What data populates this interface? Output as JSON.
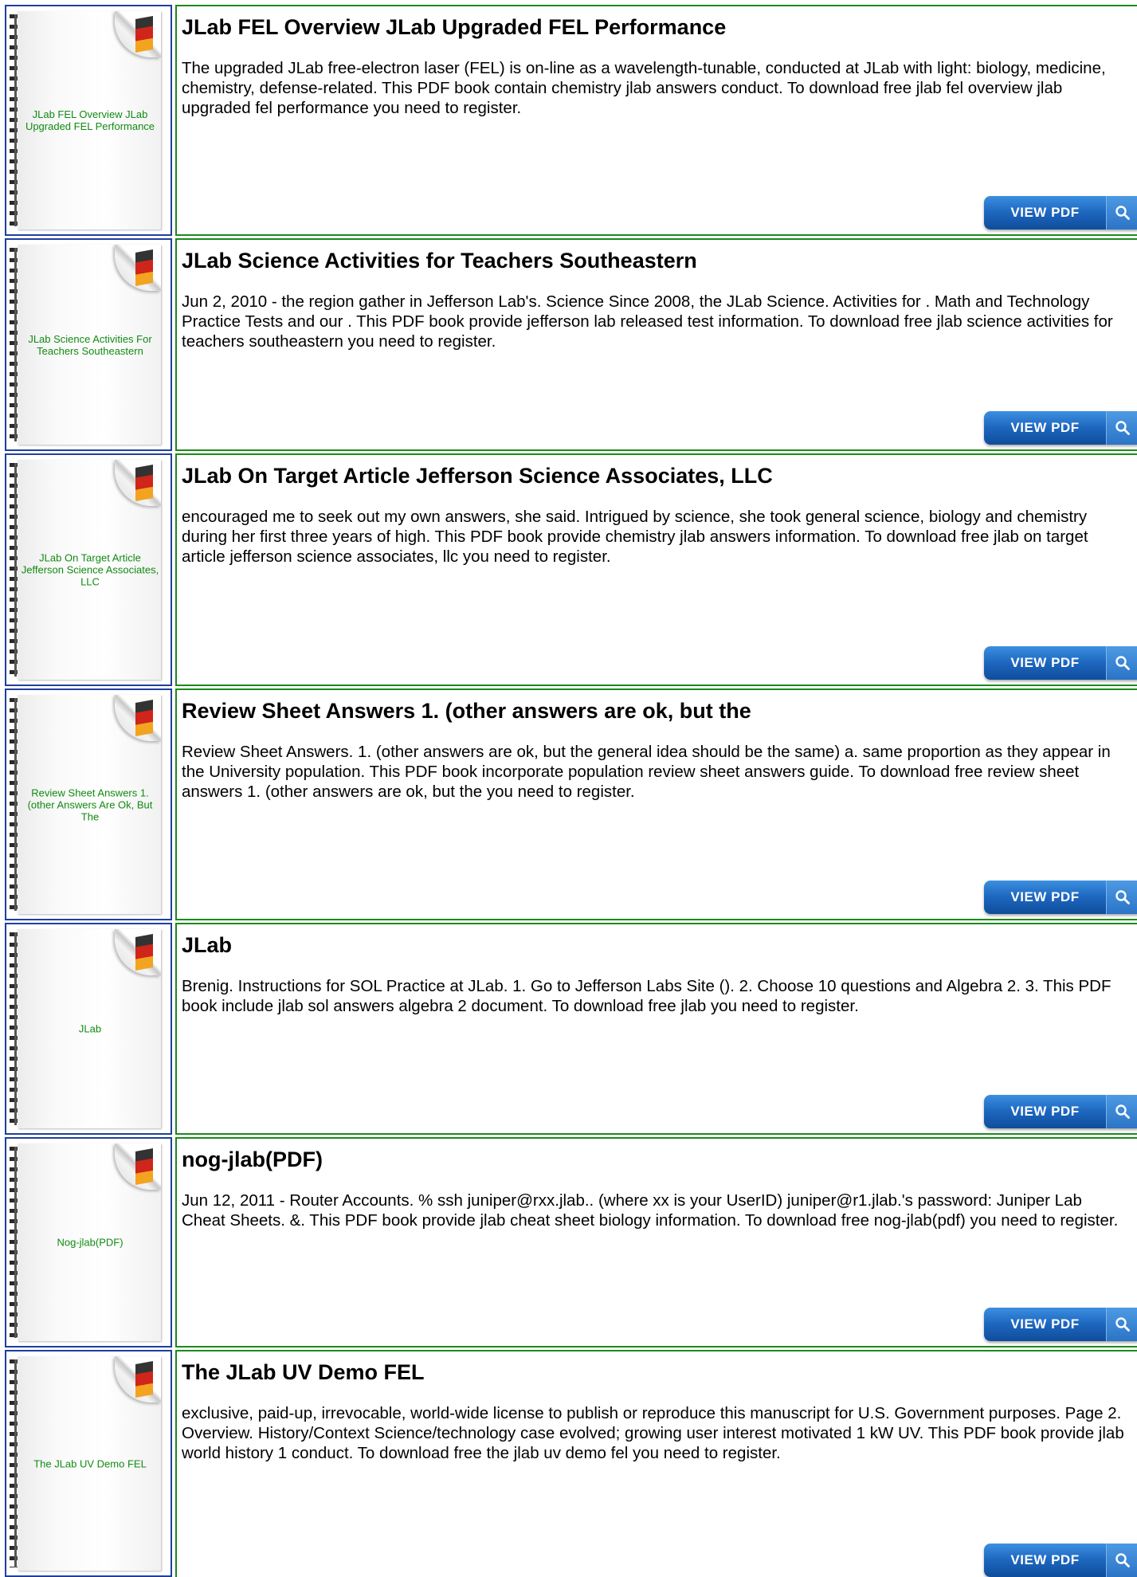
{
  "button_label": "VIEW PDF",
  "icons": {
    "view_button": "search-icon"
  },
  "colors": {
    "thumb_border": "#1f3f9e",
    "card_border": "#1b8a1b",
    "thumb_title": "#118a11",
    "button": "#1d66be"
  },
  "entries": [
    {
      "thumb_title": "JLab FEL Overview JLab Upgraded FEL Performance",
      "title": "JLab FEL Overview JLab Upgraded FEL Performance",
      "description": "The upgraded JLab free-electron laser (FEL) is on-line as a wavelength-tunable, conducted at JLab with light: biology, medicine, chemistry, defense-related. This PDF book contain chemistry jlab answers conduct. To download free jlab fel overview jlab upgraded fel performance you need to register."
    },
    {
      "thumb_title": "JLab Science Activities For Teachers Southeastern",
      "title": "JLab Science Activities for Teachers Southeastern",
      "description": "Jun 2, 2010 - the region gather in Jefferson Lab's. Science Since 2008, the JLab Science. Activities for . Math and Technology Practice Tests and our . This PDF book provide jefferson lab released test information. To download free jlab science activities for teachers southeastern you need to register."
    },
    {
      "thumb_title": "JLab On Target Article Jefferson Science Associates, LLC",
      "title": "JLab On Target Article Jefferson Science Associates, LLC",
      "description": "encouraged me to seek out my own answers, she said. Intrigued by science, she took general science, biology and chemistry during her first three years of high. This PDF book provide chemistry jlab answers information. To download free jlab on target article jefferson science associates, llc you need to register."
    },
    {
      "thumb_title": "Review Sheet Answers 1. (other Answers Are Ok, But The",
      "title": "Review Sheet Answers 1. (other answers are ok, but the",
      "description": "Review Sheet Answers. 1. (other answers are ok, but the general idea should be the same) a. same proportion as they appear in the University population. This PDF book incorporate population review sheet answers guide. To download free review sheet answers 1. (other answers are ok, but the you need to register."
    },
    {
      "thumb_title": "JLab",
      "title": "JLab",
      "description": "Brenig. Instructions for SOL Practice at JLab. 1. Go to Jefferson Labs Site (). 2. Choose 10 questions and Algebra 2. 3. This PDF book include jlab sol answers algebra 2 document. To download free jlab you need to register."
    },
    {
      "thumb_title": "Nog-jlab(PDF)",
      "title": "nog-jlab(PDF)",
      "description": "Jun 12, 2011 - Router Accounts. % ssh juniper@rxx.jlab.. (where xx is your UserID) juniper@r1.jlab.'s password: Juniper Lab Cheat Sheets. &. This PDF book provide jlab cheat sheet biology information. To download free nog-jlab(pdf) you need to register."
    },
    {
      "thumb_title": "The JLab UV Demo FEL",
      "title": "The JLab UV Demo FEL",
      "description": "exclusive, paid-up, irrevocable, world-wide license to publish or reproduce this manuscript for U.S. Government purposes. Page 2. Overview. History/Context Science/technology case evolved; growing user interest motivated 1 kW UV. This PDF book provide jlab world history 1 conduct. To download free the jlab uv demo fel you need to register."
    }
  ]
}
